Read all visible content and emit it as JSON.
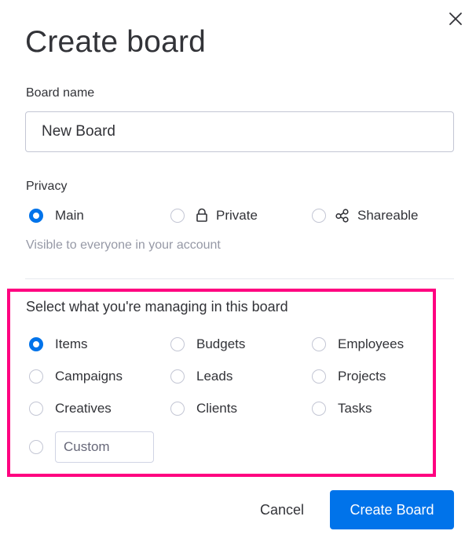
{
  "dialog": {
    "title": "Create board",
    "close_icon": "close-icon"
  },
  "board_name": {
    "label": "Board name",
    "value": "New Board"
  },
  "privacy": {
    "label": "Privacy",
    "options": [
      {
        "label": "Main",
        "icon": null,
        "checked": true
      },
      {
        "label": "Private",
        "icon": "lock-icon",
        "checked": false
      },
      {
        "label": "Shareable",
        "icon": "share-icon",
        "checked": false
      }
    ],
    "hint": "Visible to everyone in your account"
  },
  "managing": {
    "title": "Select what you're managing in this board",
    "options": [
      {
        "label": "Items",
        "checked": true
      },
      {
        "label": "Budgets",
        "checked": false
      },
      {
        "label": "Employees",
        "checked": false
      },
      {
        "label": "Campaigns",
        "checked": false
      },
      {
        "label": "Leads",
        "checked": false
      },
      {
        "label": "Projects",
        "checked": false
      },
      {
        "label": "Creatives",
        "checked": false
      },
      {
        "label": "Clients",
        "checked": false
      },
      {
        "label": "Tasks",
        "checked": false
      }
    ],
    "custom_placeholder": "Custom",
    "custom_value": ""
  },
  "footer": {
    "cancel_label": "Cancel",
    "create_label": "Create Board"
  },
  "colors": {
    "accent": "#0073ea",
    "highlight": "#ff0080",
    "text": "#323338",
    "muted": "#9699a6"
  }
}
